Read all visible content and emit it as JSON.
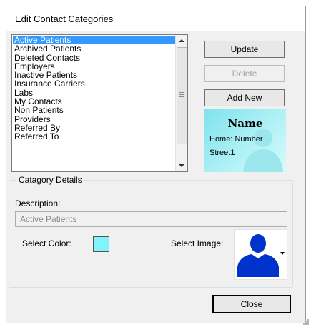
{
  "window": {
    "title": "Edit Contact Categories"
  },
  "categories": {
    "items": [
      {
        "label": "Active Patients",
        "selected": true
      },
      {
        "label": "Archived Patients"
      },
      {
        "label": "Deleted Contacts"
      },
      {
        "label": "Employers"
      },
      {
        "label": "Inactive Patients"
      },
      {
        "label": "Insurance Carriers"
      },
      {
        "label": "Labs"
      },
      {
        "label": "My Contacts"
      },
      {
        "label": "Non Patients"
      },
      {
        "label": "Providers"
      },
      {
        "label": "Referred By"
      },
      {
        "label": "Referred To"
      }
    ]
  },
  "buttons": {
    "update": "Update",
    "delete": "Delete",
    "add_new": "Add New",
    "close": "Close"
  },
  "preview": {
    "name": "Name",
    "home": "Home:  Number",
    "street": "Street1",
    "background_color": "#aff1f6"
  },
  "details": {
    "group_title": "Catagory Details",
    "description_label": "Description:",
    "description_value": "Active Patients",
    "select_color_label": "Select Color:",
    "selected_color": "#80f4f8",
    "select_image_label": "Select Image:",
    "image_icon": "person-silhouette-icon",
    "image_color": "#0033cc"
  }
}
